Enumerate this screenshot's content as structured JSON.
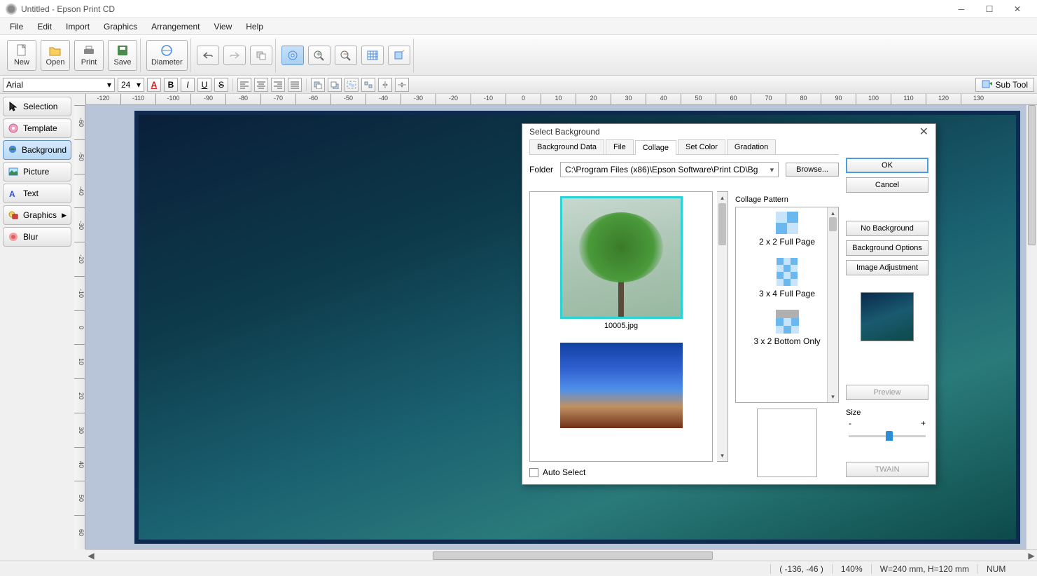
{
  "window": {
    "title": "Untitled - Epson Print CD"
  },
  "menu": [
    "File",
    "Edit",
    "Import",
    "Graphics",
    "Arrangement",
    "View",
    "Help"
  ],
  "toolbar": {
    "new": "New",
    "open": "Open",
    "print": "Print",
    "save": "Save",
    "diameter": "Diameter"
  },
  "textbar": {
    "font": "Arial",
    "size": "24",
    "subtool": "Sub Tool"
  },
  "leftTools": {
    "selection": "Selection",
    "template": "Template",
    "background": "Background",
    "picture": "Picture",
    "text": "Text",
    "graphics": "Graphics",
    "blur": "Blur"
  },
  "rulerH": [
    "-120",
    "-110",
    "-100",
    "-90",
    "-80",
    "-70",
    "-60",
    "-50",
    "-40",
    "-30",
    "-20",
    "-10",
    "0",
    "10",
    "20",
    "30",
    "40",
    "50",
    "60",
    "70",
    "80",
    "90",
    "100",
    "110",
    "120",
    "130"
  ],
  "rulerV": [
    "-60",
    "-50",
    "-40",
    "-30",
    "-20",
    "-10",
    "0",
    "10",
    "20",
    "30",
    "40",
    "50",
    "60"
  ],
  "status": {
    "coords": "( -136, -46 )",
    "zoom": "140%",
    "dims": "W=240 mm, H=120 mm",
    "num": "NUM"
  },
  "dialog": {
    "title": "Select Background",
    "tabs": [
      "Background Data",
      "File",
      "Collage",
      "Set Color",
      "Gradation"
    ],
    "activeTab": 2,
    "folderLabel": "Folder",
    "folderPath": "C:\\Program Files (x86)\\Epson Software\\Print CD\\Bg",
    "browse": "Browse...",
    "thumb1": "10005.jpg",
    "collageLabel": "Collage Pattern",
    "patterns": [
      "2 x 2 Full Page",
      "3 x 4 Full Page",
      "3 x 2 Bottom Only"
    ],
    "autoSelect": "Auto Select",
    "ok": "OK",
    "cancel": "Cancel",
    "noBg": "No Background",
    "bgOpts": "Background Options",
    "imgAdj": "Image Adjustment",
    "preview": "Preview",
    "size": "Size",
    "minus": "-",
    "plus": "+",
    "twain": "TWAIN"
  }
}
